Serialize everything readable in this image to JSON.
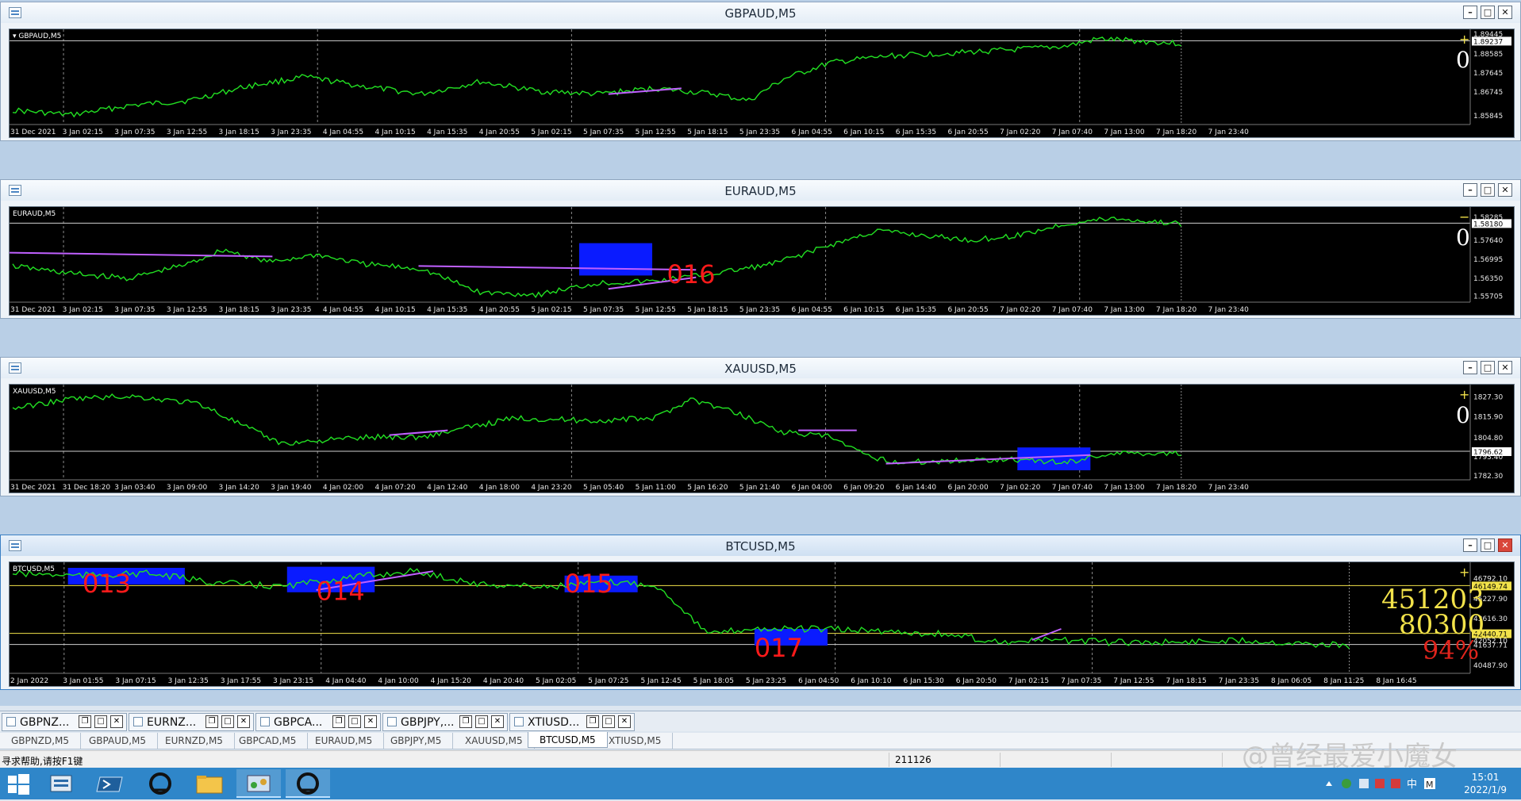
{
  "windows": [
    {
      "title": "GBPAUD,M5",
      "label": "GBPAUD,M5",
      "prices": [
        "1.89445",
        "1.89237",
        "1.88585",
        "1.87645",
        "1.86745",
        "1.85845"
      ],
      "current_price": "1.89237",
      "times": [
        "31 Dec 2021",
        "3 Jan 02:15",
        "3 Jan 07:35",
        "3 Jan 12:55",
        "3 Jan 18:15",
        "3 Jan 23:35",
        "4 Jan 04:55",
        "4 Jan 10:15",
        "4 Jan 15:35",
        "4 Jan 20:55",
        "5 Jan 02:15",
        "5 Jan 07:35",
        "5 Jan 12:55",
        "5 Jan 18:15",
        "5 Jan 23:35",
        "6 Jan 04:55",
        "6 Jan 10:15",
        "6 Jan 15:35",
        "6 Jan 20:55",
        "7 Jan 02:20",
        "7 Jan 07:40",
        "7 Jan 13:00",
        "7 Jan 18:20",
        "7 Jan 23:40"
      ],
      "sign": "+",
      "big": "0",
      "boxes": []
    },
    {
      "title": "EURAUD,M5",
      "label": "EURAUD,M5",
      "prices": [
        "1.58285",
        "1.58180",
        "1.57640",
        "1.56995",
        "1.56350",
        "1.55705"
      ],
      "current_price": "1.58180",
      "times": [
        "31 Dec 2021",
        "3 Jan 02:15",
        "3 Jan 07:35",
        "3 Jan 12:55",
        "3 Jan 18:15",
        "3 Jan 23:35",
        "4 Jan 04:55",
        "4 Jan 10:15",
        "4 Jan 15:35",
        "4 Jan 20:55",
        "5 Jan 02:15",
        "5 Jan 07:35",
        "5 Jan 12:55",
        "5 Jan 18:15",
        "5 Jan 23:35",
        "6 Jan 04:55",
        "6 Jan 10:15",
        "6 Jan 15:35",
        "6 Jan 20:55",
        "7 Jan 02:20",
        "7 Jan 07:40",
        "7 Jan 13:00",
        "7 Jan 18:20",
        "7 Jan 23:40"
      ],
      "sign": "−",
      "big": "0",
      "boxes": [
        "016"
      ]
    },
    {
      "title": "XAUUSD,M5",
      "label": "XAUUSD,M5",
      "prices": [
        "1827.30",
        "1815.90",
        "1804.80",
        "1796.62",
        "1793.40",
        "1782.30"
      ],
      "current_price": "1796.62",
      "times": [
        "31 Dec 2021",
        "31 Dec 18:20",
        "3 Jan 03:40",
        "3 Jan 09:00",
        "3 Jan 14:20",
        "3 Jan 19:40",
        "4 Jan 02:00",
        "4 Jan 07:20",
        "4 Jan 12:40",
        "4 Jan 18:00",
        "4 Jan 23:20",
        "5 Jan 05:40",
        "5 Jan 11:00",
        "5 Jan 16:20",
        "5 Jan 21:40",
        "6 Jan 04:00",
        "6 Jan 09:20",
        "6 Jan 14:40",
        "6 Jan 20:00",
        "7 Jan 02:20",
        "7 Jan 07:40",
        "7 Jan 13:00",
        "7 Jan 18:20",
        "7 Jan 23:40"
      ],
      "sign": "+",
      "big": "0",
      "boxes": []
    },
    {
      "title": "BTCUSD,M5",
      "label": "BTCUSD,M5",
      "prices": [
        "46792.10",
        "46149.74",
        "45227.90",
        "43616.30",
        "42440.71",
        "42052.10",
        "41637.71",
        "40487.90"
      ],
      "current_price": "42440.71",
      "times": [
        "2 Jan 2022",
        "3 Jan 01:55",
        "3 Jan 07:15",
        "3 Jan 12:35",
        "3 Jan 17:55",
        "3 Jan 23:15",
        "4 Jan 04:40",
        "4 Jan 10:00",
        "4 Jan 15:20",
        "4 Jan 20:40",
        "5 Jan 02:05",
        "5 Jan 07:25",
        "5 Jan 12:45",
        "5 Jan 18:05",
        "5 Jan 23:25",
        "6 Jan 04:50",
        "6 Jan 10:10",
        "6 Jan 15:30",
        "6 Jan 20:50",
        "7 Jan 02:15",
        "7 Jan 07:35",
        "7 Jan 12:55",
        "7 Jan 18:15",
        "7 Jan 23:35",
        "8 Jan 06:05",
        "8 Jan 11:25",
        "8 Jan 16:45"
      ],
      "sign": "+",
      "big1": "451203",
      "big2": "80300",
      "big3": "94%",
      "boxes": [
        "013",
        "014",
        "015",
        "017"
      ]
    }
  ],
  "mdi_tabs": [
    "GBPNZ...",
    "EURNZ...",
    "GBPCA...",
    "GBPJPY,...",
    "XTIUSD..."
  ],
  "symbol_tabs": [
    "GBPNZD,M5",
    "GBPAUD,M5",
    "EURNZD,M5",
    "GBPCAD,M5",
    "EURAUD,M5",
    "GBPJPY,M5",
    "XAUUSD,M5",
    "BTCUSD,M5",
    "XTIUSD,M5"
  ],
  "active_symbol_tab": "BTCUSD,M5",
  "status": {
    "help": "寻求帮助,请按F1键",
    "number": "211126"
  },
  "watermark": "@曾经最爱小魔女",
  "clock": {
    "time": "15:01",
    "date": "2022/1/9"
  },
  "colors": {
    "line": "#22e022",
    "box": "#0a1bff",
    "box_text": "#ff1a1a",
    "trend": "#c060ff",
    "accent_yellow": "#f2e24a"
  }
}
